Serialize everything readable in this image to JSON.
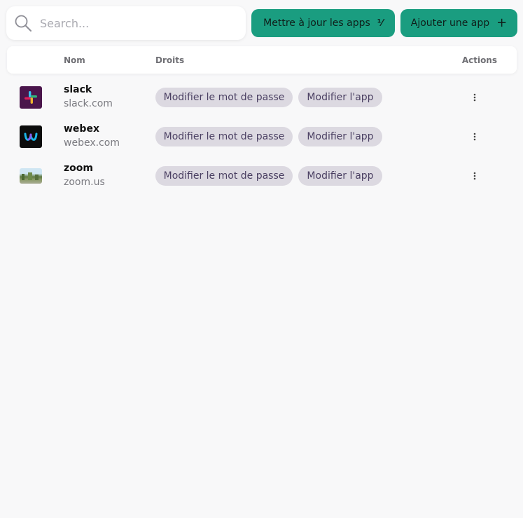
{
  "search": {
    "placeholder": "Search...",
    "value": ""
  },
  "toolbar": {
    "update_label": "Mettre à jour les apps",
    "update_glyph": "⅟",
    "add_label": "Ajouter une app",
    "add_glyph": "+"
  },
  "table": {
    "headers": {
      "name": "Nom",
      "rights": "Droits",
      "actions": "Actions"
    },
    "rows": [
      {
        "name": "slack",
        "domain": "slack.com",
        "logo": "slack-logo",
        "rights": [
          "Modifier le mot de passe",
          "Modifier l'app"
        ]
      },
      {
        "name": "webex",
        "domain": "webex.com",
        "logo": "webex-logo",
        "rights": [
          "Modifier le mot de passe",
          "Modifier l'app"
        ]
      },
      {
        "name": "zoom",
        "domain": "zoom.us",
        "logo": "zoom-logo-image",
        "rights": [
          "Modifier le mot de passe",
          "Modifier l'app"
        ]
      }
    ]
  },
  "colors": {
    "background": "#f8f8f9",
    "accent": "#1a9d80",
    "chip_bg": "#dcd9e1",
    "chip_text": "#4a3f62"
  }
}
